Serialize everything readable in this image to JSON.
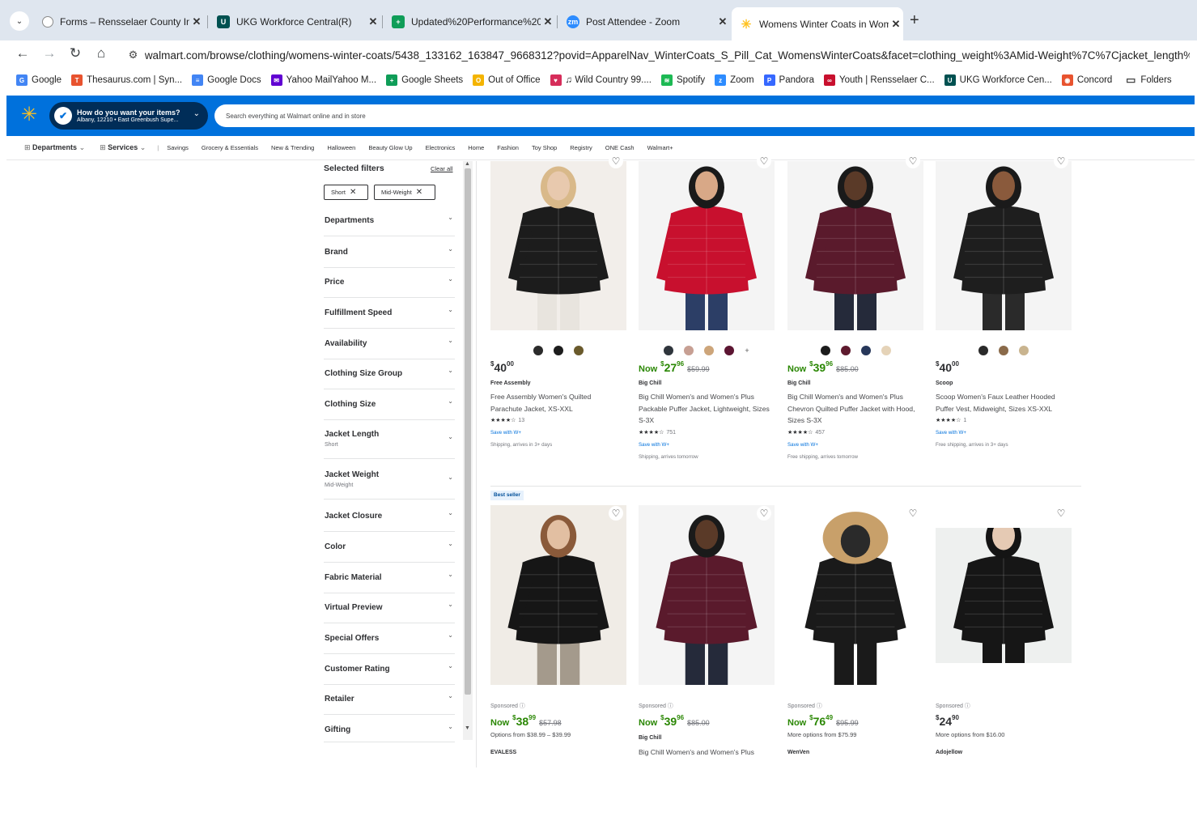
{
  "browser": {
    "tabs": [
      {
        "title": "Forms – Rensselaer County Intra",
        "icon": "clock-favicon-icon"
      },
      {
        "title": "UKG Workforce Central(R)",
        "icon": "ukg-favicon-icon"
      },
      {
        "title": "Updated%20Performance%20R",
        "icon": "sheets-favicon-icon"
      },
      {
        "title": "Post Attendee - Zoom",
        "icon": "zoom-favicon-icon"
      },
      {
        "title": "Womens Winter Coats in Wome",
        "icon": "walmart-favicon-icon",
        "active": true
      }
    ],
    "url": "walmart.com/browse/clothing/womens-winter-coats/5438_133162_163847_9668312?povid=ApparelNav_WinterCoats_S_Pill_Cat_WomensWinterCoats&facet=clothing_weight%3AMid-Weight%7C%7Cjacket_length%3AShort",
    "bookmarks": [
      {
        "label": "Google",
        "icon": "google-icon",
        "color": "#4285f4",
        "glyph": "G"
      },
      {
        "label": "Thesaurus.com | Syn...",
        "icon": "thesaurus-icon",
        "color": "#e8532f",
        "glyph": "T"
      },
      {
        "label": "Google Docs",
        "icon": "docs-icon",
        "color": "#4285f4",
        "glyph": "≡"
      },
      {
        "label": "Yahoo MailYahoo M...",
        "icon": "yahoo-mail-icon",
        "color": "#6001d2",
        "glyph": "✉"
      },
      {
        "label": "Google Sheets",
        "icon": "sheets-icon",
        "color": "#0f9d58",
        "glyph": "+"
      },
      {
        "label": "Out of Office",
        "icon": "out-of-office-icon",
        "color": "#f4b400",
        "glyph": "O"
      },
      {
        "label": "♫ Wild Country 99....",
        "icon": "wild-country-icon",
        "color": "#d62d5a",
        "glyph": "♥"
      },
      {
        "label": "Spotify",
        "icon": "spotify-icon",
        "color": "#1db954",
        "glyph": "≋"
      },
      {
        "label": "Zoom",
        "icon": "zoom-icon",
        "color": "#2d8cff",
        "glyph": "z"
      },
      {
        "label": "Pandora",
        "icon": "pandora-icon",
        "color": "#3668ff",
        "glyph": "P"
      },
      {
        "label": "Youth | Rensselaer C...",
        "icon": "youth-icon",
        "color": "#c8102e",
        "glyph": "∞"
      },
      {
        "label": "UKG Workforce Cen...",
        "icon": "ukg-icon",
        "color": "#005151",
        "glyph": "U"
      },
      {
        "label": "Concord",
        "icon": "concord-icon",
        "color": "#e8532f",
        "glyph": "◉"
      },
      {
        "label": "Folders",
        "icon": "folder-icon",
        "color": "#ffffff",
        "glyph": "▭"
      }
    ]
  },
  "header": {
    "location_title": "How do you want your items?",
    "location_sub": "Albany, 12210 • East Greenbush Supe...",
    "search_placeholder": "Search everything at Walmart online and in store"
  },
  "nav": {
    "departments": "Departments",
    "services": "Services",
    "items": [
      "Savings",
      "Grocery & Essentials",
      "New & Trending",
      "Halloween",
      "Beauty Glow Up",
      "Electronics",
      "Home",
      "Fashion",
      "Toy Shop",
      "Registry",
      "ONE Cash",
      "Walmart+"
    ]
  },
  "filters": {
    "title": "Selected filters",
    "clear_all": "Clear all",
    "chips": [
      "Short",
      "Mid-Weight"
    ],
    "rows": [
      {
        "label": "Departments",
        "sub": ""
      },
      {
        "label": "Brand",
        "sub": ""
      },
      {
        "label": "Price",
        "sub": ""
      },
      {
        "label": "Fulfillment Speed",
        "sub": ""
      },
      {
        "label": "Availability",
        "sub": ""
      },
      {
        "label": "Clothing Size Group",
        "sub": ""
      },
      {
        "label": "Clothing Size",
        "sub": ""
      },
      {
        "label": "Jacket Length",
        "sub": "Short"
      },
      {
        "label": "Jacket Weight",
        "sub": "Mid-Weight"
      },
      {
        "label": "Jacket Closure",
        "sub": ""
      },
      {
        "label": "Color",
        "sub": ""
      },
      {
        "label": "Fabric Material",
        "sub": ""
      },
      {
        "label": "Virtual Preview",
        "sub": ""
      },
      {
        "label": "Special Offers",
        "sub": ""
      },
      {
        "label": "Customer Rating",
        "sub": ""
      },
      {
        "label": "Retailer",
        "sub": ""
      },
      {
        "label": "Gifting",
        "sub": ""
      }
    ]
  },
  "products_row1": [
    {
      "price_prefix": "",
      "price_dollars": "40",
      "price_cents": "00",
      "was": "",
      "brand": "Free Assembly",
      "name": "Free Assembly Women's Quilted Parachute Jacket, XS-XXL",
      "rating_count": "13",
      "swatches": [
        "#2b2b2b",
        "#1d1d1d",
        "#6a5a2c"
      ],
      "save_with": "Save with W+",
      "shipping": "Shipping, arrives in 3+ days",
      "image_colors": {
        "bg": "#f2eeea",
        "coat": "#1c1c1c",
        "skin": "#e8c9ae",
        "hair": "#d9b98a",
        "pants": "#e8e4de"
      }
    },
    {
      "price_prefix": "Now",
      "price_dollars": "27",
      "price_cents": "96",
      "was": "$59.99",
      "brand": "Big Chill",
      "name": "Big Chill Women's and Women's Plus Packable Puffer Jacket, Lightweight, Sizes S-3X",
      "rating_count": "751",
      "swatches": [
        "#2f353c",
        "#c79f93",
        "#cda57a",
        "#5c1532"
      ],
      "more": "+",
      "save_with": "Save with W+",
      "shipping": "Shipping, arrives tomorrow",
      "image_colors": {
        "bg": "#f4f4f4",
        "coat": "#c8102e",
        "skin": "#d8a887",
        "hair": "#1a1a1a",
        "pants": "#2c3e66"
      }
    },
    {
      "price_prefix": "Now",
      "price_dollars": "39",
      "price_cents": "96",
      "was": "$85.00",
      "brand": "Big Chill",
      "name": "Big Chill Women's and Women's Plus Chevron Quilted Puffer Jacket with Hood, Sizes S-3X",
      "rating_count": "457",
      "swatches": [
        "#1c1c1c",
        "#5e1a2e",
        "#27375a",
        "#e5d3b8"
      ],
      "save_with": "Save with W+",
      "shipping": "Free shipping, arrives tomorrow",
      "image_colors": {
        "bg": "#f4f4f4",
        "coat": "#5a1a2c",
        "skin": "#5a3a28",
        "hair": "#1a1a1a",
        "pants": "#252a3a"
      }
    },
    {
      "price_prefix": "",
      "price_dollars": "40",
      "price_cents": "00",
      "was": "",
      "brand": "Scoop",
      "name": "Scoop Women's Faux Leather Hooded Puffer Vest, Midweight, Sizes XS-XXL",
      "rating_count": "1",
      "swatches": [
        "#2a2a2a",
        "#8a6a4a",
        "#c9b48f"
      ],
      "save_with": "Save with W+",
      "shipping": "Free shipping, arrives in 3+ days",
      "image_colors": {
        "bg": "#f4f4f4",
        "coat": "#1e1e1e",
        "skin": "#8a5a3c",
        "hair": "#1a1a1a",
        "pants": "#2a2a2a"
      }
    }
  ],
  "best_seller": "Best seller",
  "products_row2": [
    {
      "sponsored": "Sponsored",
      "price_prefix": "Now",
      "price_dollars": "38",
      "price_cents": "99",
      "was": "$57.98",
      "options": "Options from $38.99 – $39.99",
      "brand": "EVALESS",
      "image_colors": {
        "bg": "#f0ece6",
        "coat": "#161616",
        "skin": "#e2bfa2",
        "hair": "#8a5a3a",
        "pants": "#a49a8c"
      }
    },
    {
      "sponsored": "Sponsored",
      "price_prefix": "Now",
      "price_dollars": "39",
      "price_cents": "96",
      "was": "$85.00",
      "options": "",
      "brand": "Big Chill",
      "name": "Big Chill Women's and Women's Plus",
      "image_colors": {
        "bg": "#f4f4f4",
        "coat": "#5a1a2c",
        "skin": "#5a3a28",
        "hair": "#1a1a1a",
        "pants": "#252a3a"
      }
    },
    {
      "sponsored": "Sponsored",
      "price_prefix": "Now",
      "price_dollars": "76",
      "price_cents": "49",
      "was": "$95.99",
      "options": "More options from $75.99",
      "brand": "WenVen",
      "image_colors": {
        "bg": "#ffffff",
        "coat": "#1a1a1a",
        "skin": "#ffffff",
        "hair": "#c8a06a",
        "pants": "#1a1a1a"
      }
    },
    {
      "sponsored": "Sponsored",
      "price_prefix": "",
      "price_dollars": "24",
      "price_cents": "90",
      "was": "",
      "options": "More options from $16.00",
      "brand": "Adojellow",
      "image_colors": {
        "bg": "#eef0ef",
        "coat": "#161616",
        "skin": "#e5cab4",
        "hair": "#141414",
        "pants": "#161616"
      }
    }
  ]
}
